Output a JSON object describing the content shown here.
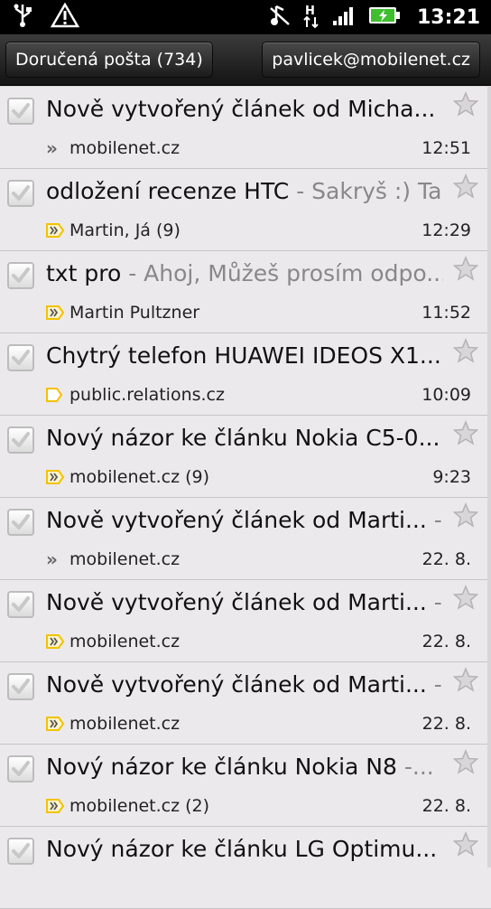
{
  "status_bar": {
    "time": "13:21",
    "icons": [
      "usb-icon",
      "warning-icon",
      "silent-icon",
      "hspa-icon",
      "signal-icon",
      "battery-charging-icon"
    ]
  },
  "header": {
    "folder_label": "Doručená pošta (734)",
    "account": "pavlicek@mobilenet.cz"
  },
  "messages": [
    {
      "subject": "Nově vytvořený článek od Micha...",
      "snippet": "",
      "sender": "mobilenet.cz",
      "time": "12:51",
      "marker": "chevrons"
    },
    {
      "subject": "odložení recenze HTC",
      "snippet": " - Sakryš :) Ta...",
      "sender": "Martin, Já (9)",
      "time": "12:29",
      "marker": "important"
    },
    {
      "subject": "txt pro",
      "snippet": " - Ahoj, Můžeš prosím odpo...",
      "sender": "Martin Pultzner",
      "time": "11:52",
      "marker": "important"
    },
    {
      "subject": "Chytrý telefon HUAWEI IDEOS X1...",
      "snippet": "",
      "sender": "public.relations.cz",
      "time": "10:09",
      "marker": "label"
    },
    {
      "subject": "Nový názor ke článku Nokia C5-0...",
      "snippet": "",
      "sender": "mobilenet.cz (9)",
      "time": "9:23",
      "marker": "important"
    },
    {
      "subject": "Nově vytvořený článek od Marti...",
      "snippet": " - ...",
      "sender": "mobilenet.cz",
      "time": "22. 8.",
      "marker": "chevrons"
    },
    {
      "subject": "Nově vytvořený článek od Marti...",
      "snippet": " - ...",
      "sender": "mobilenet.cz",
      "time": "22. 8.",
      "marker": "important"
    },
    {
      "subject": "Nově vytvořený článek od Marti...",
      "snippet": " - ...",
      "sender": "mobilenet.cz",
      "time": "22. 8.",
      "marker": "important"
    },
    {
      "subject": "Nový názor ke článku Nokia N8",
      "snippet": " -...",
      "sender": "mobilenet.cz (2)",
      "time": "22. 8.",
      "marker": "important"
    },
    {
      "subject": "Nový názor ke článku LG Optimu...",
      "snippet": "",
      "sender": "",
      "time": "",
      "marker": ""
    }
  ],
  "colors": {
    "row_bg": "#ece9ec",
    "important_tag": "#f2c200",
    "snippet_text": "#888888"
  }
}
